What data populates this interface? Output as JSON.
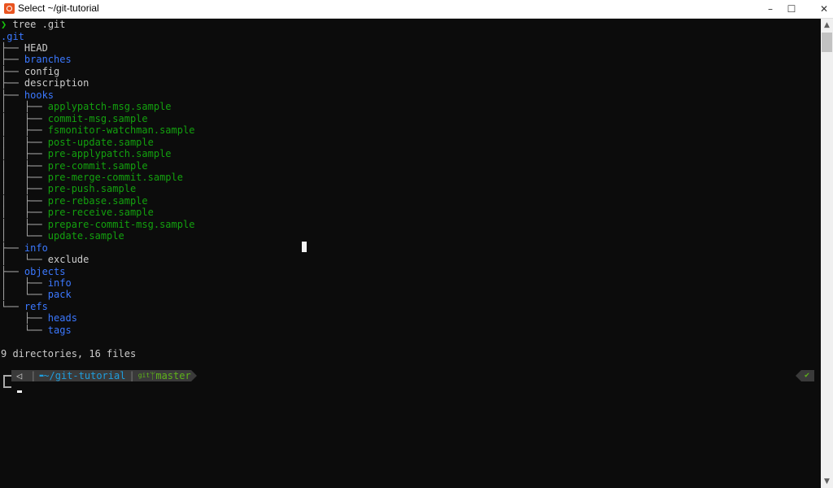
{
  "window": {
    "title": "Select ~/git-tutorial",
    "minimize_icon": "–",
    "maximize_icon": "☐",
    "close_icon": "✕"
  },
  "terminal": {
    "prompt_symbol": "❯",
    "command": "tree .git",
    "root": ".git",
    "tree_lines": [
      {
        "prefix": "├── ",
        "name": "HEAD",
        "type": "file"
      },
      {
        "prefix": "├── ",
        "name": "branches",
        "type": "dir"
      },
      {
        "prefix": "├── ",
        "name": "config",
        "type": "file"
      },
      {
        "prefix": "├── ",
        "name": "description",
        "type": "file"
      },
      {
        "prefix": "├── ",
        "name": "hooks",
        "type": "dir"
      },
      {
        "prefix": "│   ├── ",
        "name": "applypatch-msg.sample",
        "type": "exec"
      },
      {
        "prefix": "│   ├── ",
        "name": "commit-msg.sample",
        "type": "exec"
      },
      {
        "prefix": "│   ├── ",
        "name": "fsmonitor-watchman.sample",
        "type": "exec"
      },
      {
        "prefix": "│   ├── ",
        "name": "post-update.sample",
        "type": "exec"
      },
      {
        "prefix": "│   ├── ",
        "name": "pre-applypatch.sample",
        "type": "exec"
      },
      {
        "prefix": "│   ├── ",
        "name": "pre-commit.sample",
        "type": "exec"
      },
      {
        "prefix": "│   ├── ",
        "name": "pre-merge-commit.sample",
        "type": "exec"
      },
      {
        "prefix": "│   ├── ",
        "name": "pre-push.sample",
        "type": "exec"
      },
      {
        "prefix": "│   ├── ",
        "name": "pre-rebase.sample",
        "type": "exec"
      },
      {
        "prefix": "│   ├── ",
        "name": "pre-receive.sample",
        "type": "exec"
      },
      {
        "prefix": "│   ├── ",
        "name": "prepare-commit-msg.sample",
        "type": "exec"
      },
      {
        "prefix": "│   └── ",
        "name": "update.sample",
        "type": "exec"
      },
      {
        "prefix": "├── ",
        "name": "info",
        "type": "dir"
      },
      {
        "prefix": "│   └── ",
        "name": "exclude",
        "type": "file"
      },
      {
        "prefix": "├── ",
        "name": "objects",
        "type": "dir"
      },
      {
        "prefix": "│   ├── ",
        "name": "info",
        "type": "dir"
      },
      {
        "prefix": "│   └── ",
        "name": "pack",
        "type": "dir"
      },
      {
        "prefix": "└── ",
        "name": "refs",
        "type": "dir"
      },
      {
        "prefix": "    ├── ",
        "name": "heads",
        "type": "dir"
      },
      {
        "prefix": "    └── ",
        "name": "tags",
        "type": "dir"
      }
    ],
    "summary": "9 directories, 16 files",
    "powerline": {
      "os_icon": "◁",
      "folder_icon": "▬",
      "path": "~/git-tutorial",
      "git_icon": "git",
      "branch_icon": "ᛘ",
      "branch": "master",
      "status_icon": "✔"
    }
  },
  "colors": {
    "dir": "#3b78ff",
    "exec": "#13a10e",
    "file": "#cccccc",
    "background": "#0c0c0c"
  },
  "scrollbar": {
    "up_icon": "▲",
    "down_icon": "▼"
  }
}
